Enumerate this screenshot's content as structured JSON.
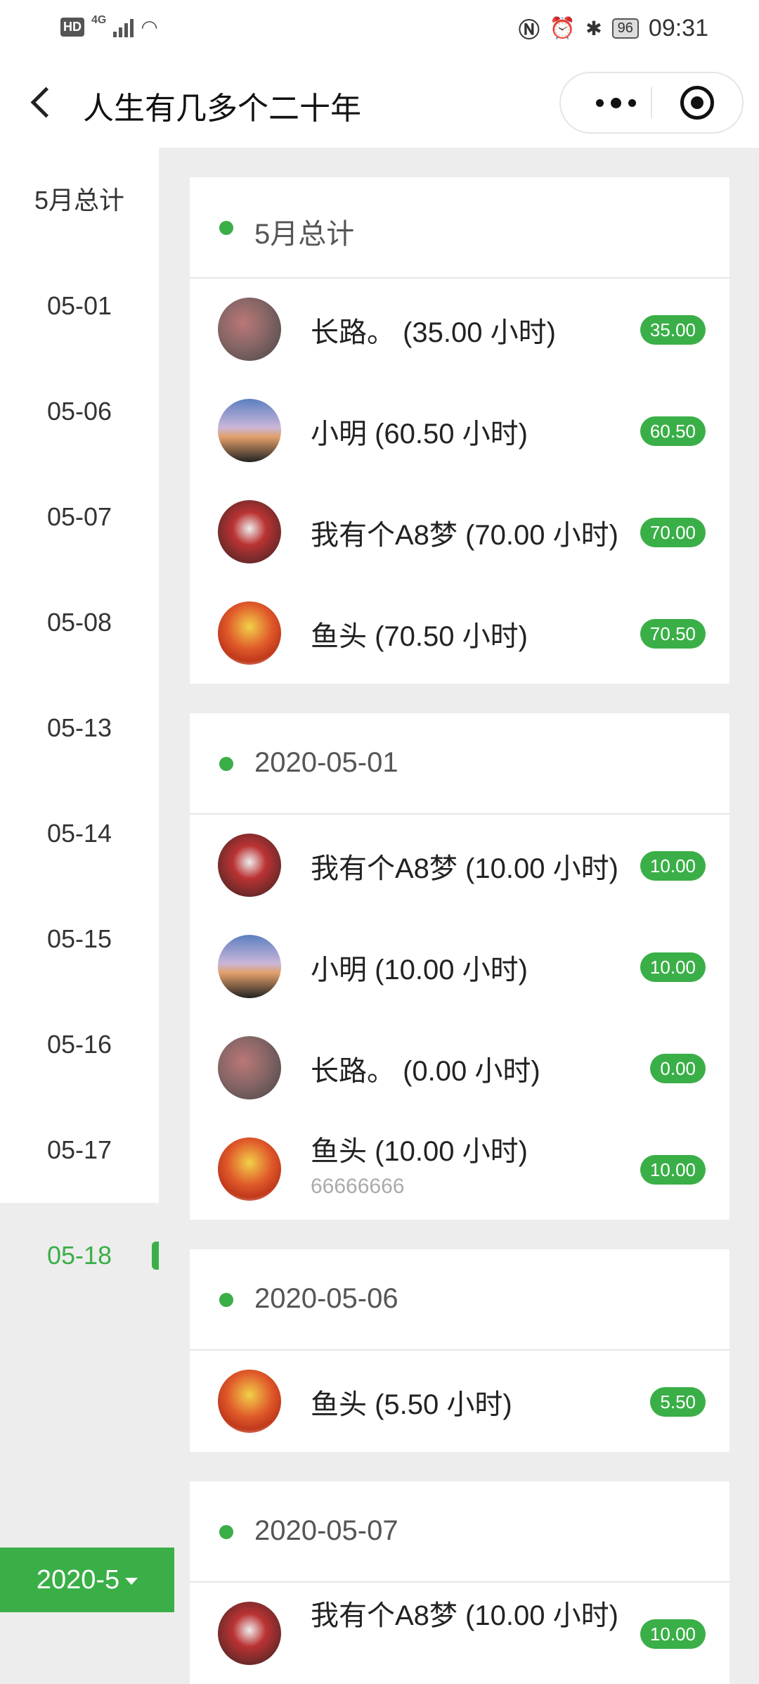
{
  "status": {
    "time": "09:31",
    "battery": "96",
    "hd": "HD",
    "net": "4G"
  },
  "nav": {
    "title": "人生有几多个二十年"
  },
  "sidebar": {
    "items": [
      {
        "label": "5月总计"
      },
      {
        "label": "05-01"
      },
      {
        "label": "05-06"
      },
      {
        "label": "05-07"
      },
      {
        "label": "05-08"
      },
      {
        "label": "05-13"
      },
      {
        "label": "05-14"
      },
      {
        "label": "05-15"
      },
      {
        "label": "05-16"
      },
      {
        "label": "05-17"
      },
      {
        "label": "05-18"
      }
    ],
    "month_button": "2020-5"
  },
  "sections": [
    {
      "title": "5月总计",
      "rows": [
        {
          "name": "长路。 (35.00 小时)",
          "badge": "35.00",
          "avatar": "a1"
        },
        {
          "name": "小明 (60.50 小时)",
          "badge": "60.50",
          "avatar": "a2"
        },
        {
          "name": "我有个A8梦 (70.00 小时)",
          "badge": "70.00",
          "avatar": "a3"
        },
        {
          "name": "鱼头 (70.50 小时)",
          "badge": "70.50",
          "avatar": "a4"
        }
      ]
    },
    {
      "title": "2020-05-01",
      "rows": [
        {
          "name": "我有个A8梦 (10.00 小时)",
          "badge": "10.00",
          "avatar": "a3"
        },
        {
          "name": "小明 (10.00 小时)",
          "badge": "10.00",
          "avatar": "a2"
        },
        {
          "name": "长路。 (0.00 小时)",
          "badge": "0.00",
          "avatar": "a1"
        },
        {
          "name": "鱼头 (10.00 小时)",
          "sub": "66666666",
          "badge": "10.00",
          "avatar": "a4"
        }
      ]
    },
    {
      "title": "2020-05-06",
      "rows": [
        {
          "name": "鱼头 (5.50 小时)",
          "badge": "5.50",
          "avatar": "a4"
        }
      ]
    },
    {
      "title": "2020-05-07",
      "rows": [
        {
          "name": "我有个A8梦 (10.00 小时)",
          "badge": "10.00",
          "avatar": "a3"
        }
      ]
    }
  ]
}
